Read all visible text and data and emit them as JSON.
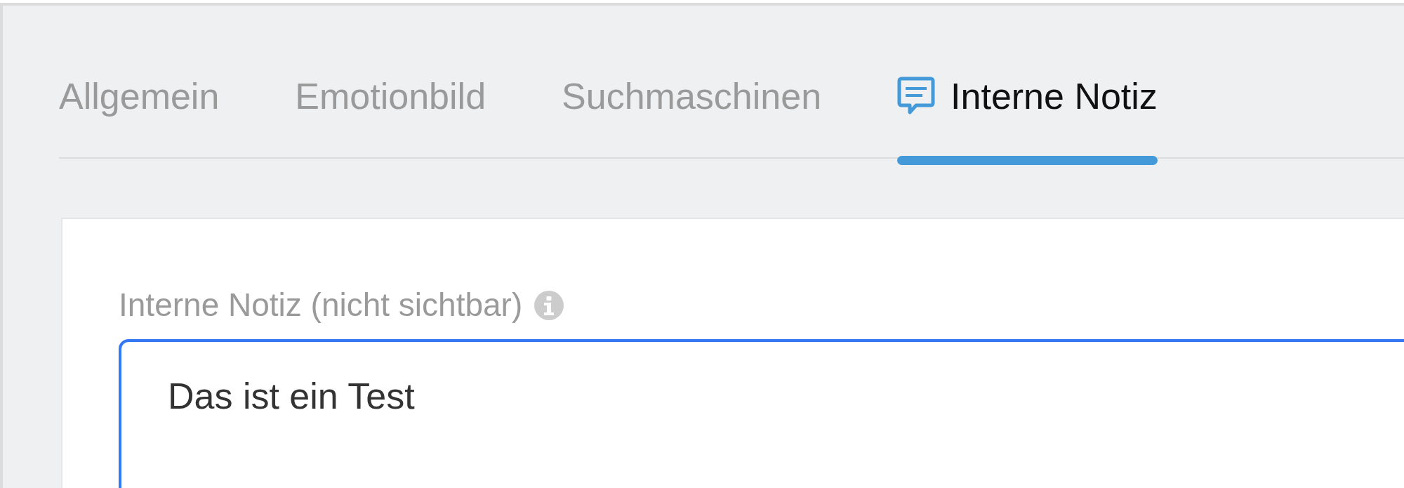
{
  "tabs": [
    {
      "label": "Allgemein",
      "selected": false
    },
    {
      "label": "Emotionbild",
      "selected": false
    },
    {
      "label": "Suchmaschinen",
      "selected": false
    },
    {
      "label": "Interne Notiz",
      "selected": true
    }
  ],
  "note": {
    "label": "Interne Notiz (nicht sichtbar)",
    "value": "Das ist ein Test",
    "focused": true
  }
}
